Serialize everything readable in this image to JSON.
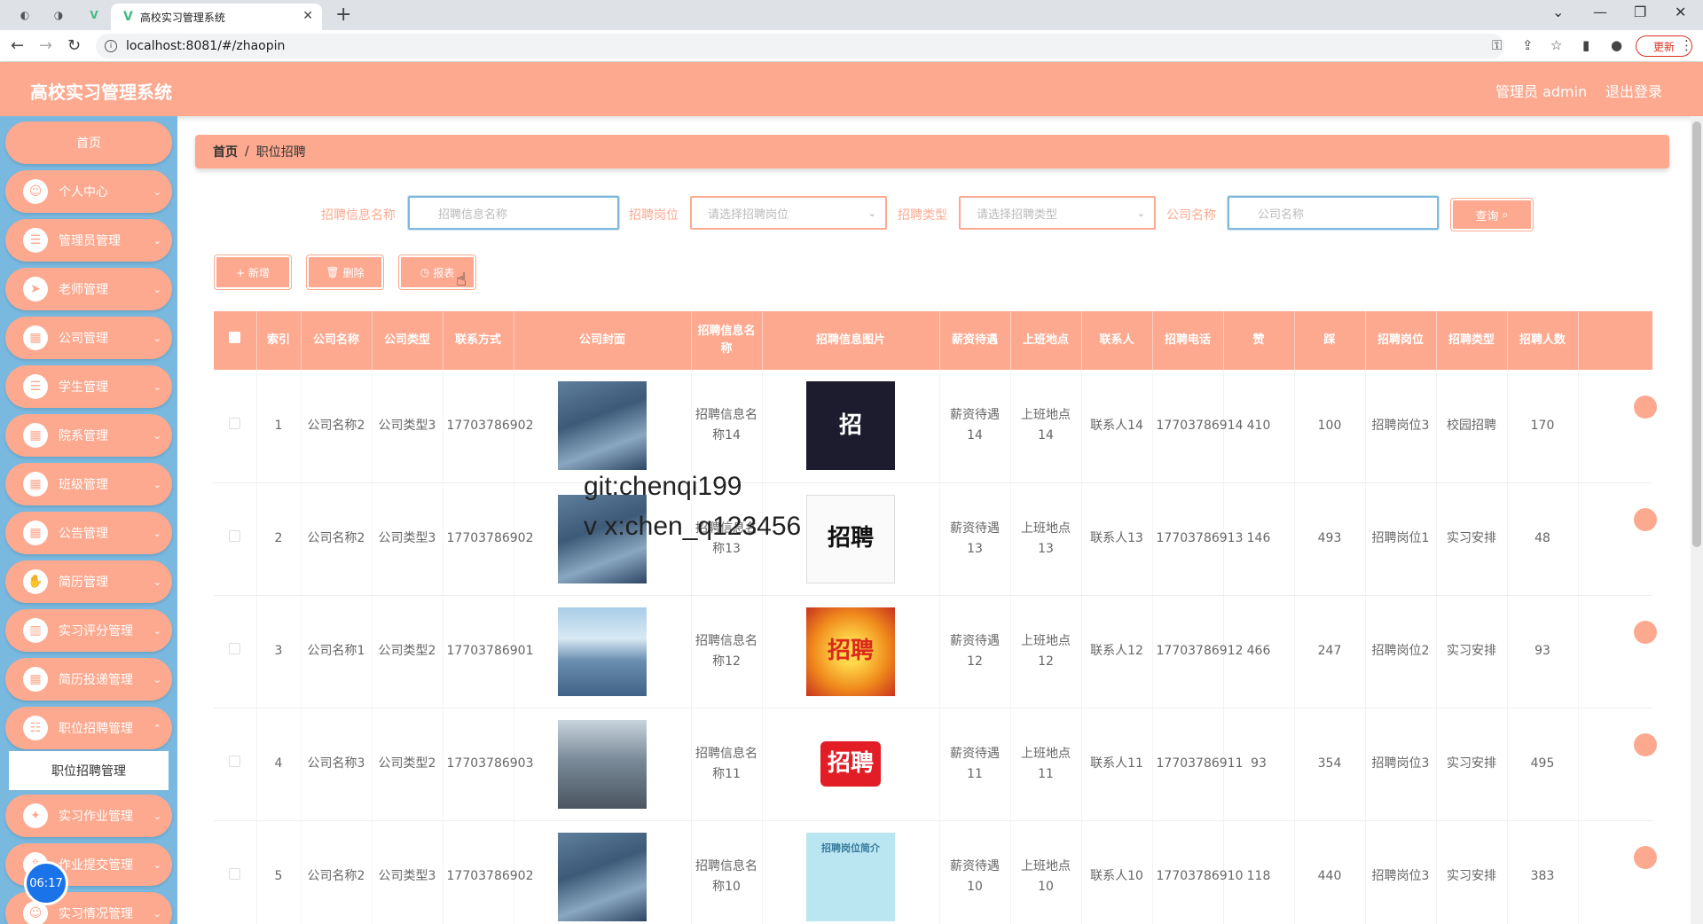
{
  "browser": {
    "tab_title": "高校实习管理系统",
    "url": "localhost:8081/#/zhaopin",
    "update_label": "更新"
  },
  "header": {
    "app_title": "高校实习管理系统",
    "user_label": "管理员 admin",
    "logout_label": "退出登录"
  },
  "sidebar": {
    "home": "首页",
    "items": [
      {
        "label": "个人中心",
        "icon": "user-icon"
      },
      {
        "label": "管理员管理",
        "icon": "list-icon"
      },
      {
        "label": "老师管理",
        "icon": "send-icon"
      },
      {
        "label": "公司管理",
        "icon": "grid-icon"
      },
      {
        "label": "学生管理",
        "icon": "list-icon"
      },
      {
        "label": "院系管理",
        "icon": "grid-icon"
      },
      {
        "label": "班级管理",
        "icon": "grid-icon"
      },
      {
        "label": "公告管理",
        "icon": "grid-icon"
      },
      {
        "label": "简历管理",
        "icon": "thumb-icon"
      },
      {
        "label": "实习评分管理",
        "icon": "bar-chart-icon"
      },
      {
        "label": "简历投递管理",
        "icon": "grid-icon"
      },
      {
        "label": "职位招聘管理",
        "icon": "sliders-icon"
      },
      {
        "label": "实习作业管理",
        "icon": "ticket-icon"
      },
      {
        "label": "作业提交管理",
        "icon": "upload-icon"
      },
      {
        "label": "实习情况管理",
        "icon": "user-icon"
      }
    ],
    "submenu_active": "职位招聘管理",
    "clock": "06:17"
  },
  "breadcrumb": {
    "home": "首页",
    "separator": "/",
    "current": "职位招聘"
  },
  "search": {
    "name_label": "招聘信息名称",
    "name_placeholder": "招聘信息名称",
    "position_label": "招聘岗位",
    "position_placeholder": "请选择招聘岗位",
    "type_label": "招聘类型",
    "type_placeholder": "请选择招聘类型",
    "company_label": "公司名称",
    "company_placeholder": "公司名称",
    "query_label": "查询"
  },
  "actions": {
    "add": "+ 新增",
    "delete": "删除",
    "report": "报表"
  },
  "table": {
    "headers": [
      "索引",
      "公司名称",
      "公司类型",
      "联系方式",
      "公司封面",
      "招聘信息名称",
      "招聘信息图片",
      "薪资待遇",
      "上班地点",
      "联系人",
      "招聘电话",
      "赞",
      "踩",
      "招聘岗位",
      "招聘类型",
      "招聘人数"
    ],
    "rows": [
      {
        "index": "1",
        "company": "公司名称2",
        "ctype": "公司类型3",
        "contact": "17703786902",
        "info_name": "招聘信息名称14",
        "salary": "薪资待遇14",
        "location": "上班地点14",
        "person": "联系人14",
        "phone": "17703786914",
        "likes": "410",
        "dislikes": "100",
        "position": "招聘岗位3",
        "rtype": "校园招聘",
        "count": "170",
        "poster": "招"
      },
      {
        "index": "2",
        "company": "公司名称2",
        "ctype": "公司类型3",
        "contact": "17703786902",
        "info_name": "招聘信息名称13",
        "salary": "薪资待遇13",
        "location": "上班地点13",
        "person": "联系人13",
        "phone": "17703786913",
        "likes": "146",
        "dislikes": "493",
        "position": "招聘岗位1",
        "rtype": "实习安排",
        "count": "48",
        "poster": "招聘"
      },
      {
        "index": "3",
        "company": "公司名称1",
        "ctype": "公司类型2",
        "contact": "17703786901",
        "info_name": "招聘信息名称12",
        "salary": "薪资待遇12",
        "location": "上班地点12",
        "person": "联系人12",
        "phone": "17703786912",
        "likes": "466",
        "dislikes": "247",
        "position": "招聘岗位2",
        "rtype": "实习安排",
        "count": "93",
        "poster": "招聘"
      },
      {
        "index": "4",
        "company": "公司名称3",
        "ctype": "公司类型2",
        "contact": "17703786903",
        "info_name": "招聘信息名称11",
        "salary": "薪资待遇11",
        "location": "上班地点11",
        "person": "联系人11",
        "phone": "17703786911",
        "likes": "93",
        "dislikes": "354",
        "position": "招聘岗位3",
        "rtype": "实习安排",
        "count": "495",
        "poster": "招聘"
      },
      {
        "index": "5",
        "company": "公司名称2",
        "ctype": "公司类型3",
        "contact": "17703786902",
        "info_name": "招聘信息名称10",
        "salary": "薪资待遇10",
        "location": "上班地点10",
        "person": "联系人10",
        "phone": "17703786910",
        "likes": "118",
        "dislikes": "440",
        "position": "招聘岗位3",
        "rtype": "实习安排",
        "count": "383",
        "poster": "招聘岗位简介"
      }
    ]
  },
  "watermark": {
    "line1": "git:chenqi199",
    "line2": "v x:chen_q123456"
  },
  "colors": {
    "accent": "#fca98f",
    "sidebar_bg": "#79b9e0"
  }
}
